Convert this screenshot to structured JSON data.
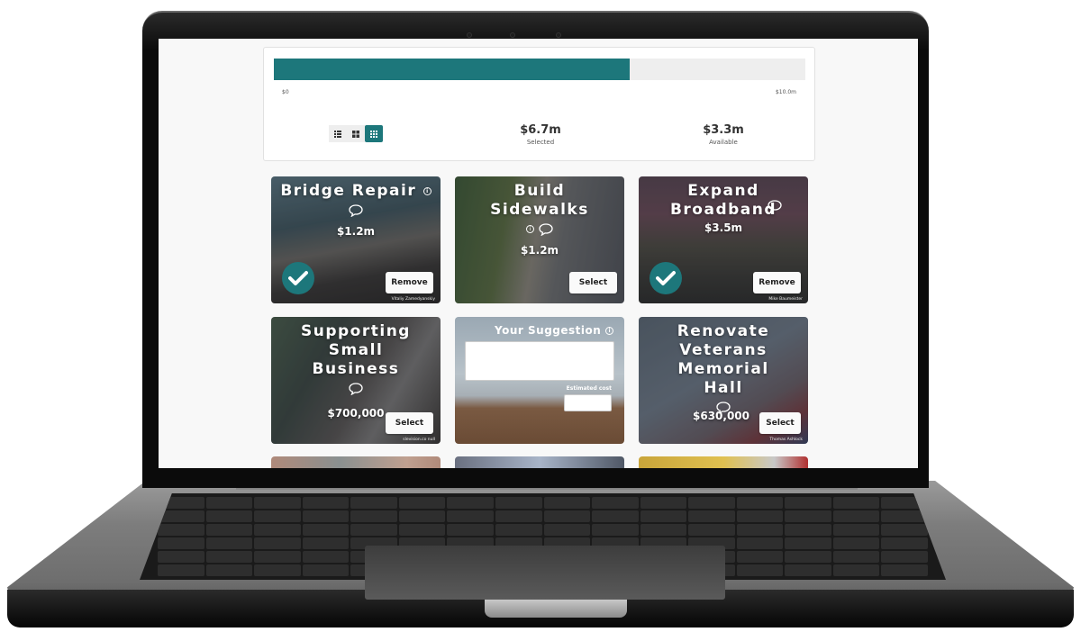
{
  "budget": {
    "min_label": "$0",
    "max_label": "$10.0m",
    "selected_fraction": 0.67,
    "selected_value": "$6.7m",
    "selected_label": "Selected",
    "available_value": "$3.3m",
    "available_label": "Available",
    "view_modes": [
      {
        "name": "list",
        "active": false
      },
      {
        "name": "grid-large",
        "active": false
      },
      {
        "name": "grid-small",
        "active": true
      }
    ]
  },
  "colors": {
    "accent": "#1d777b",
    "track": "#eeeeee",
    "page_bg": "#f8f8f8"
  },
  "projects": [
    {
      "title": "Bridge Repair",
      "has_info": true,
      "price": "$1.2m",
      "selected": true,
      "button": "Remove",
      "credit": "Vitaliy Zamedyanskiy"
    },
    {
      "title": "Build Sidewalks",
      "has_info": true,
      "price": "$1.2m",
      "selected": false,
      "button": "Select",
      "credit": ""
    },
    {
      "title": "Expand Broadband",
      "has_info": false,
      "price": "$3.5m",
      "selected": true,
      "button": "Remove",
      "credit": "Mike Baumeister"
    },
    {
      "title": "Supporting Small Business",
      "has_info": false,
      "price": "$700,000",
      "selected": false,
      "button": "Select",
      "credit": "slevision.co null"
    },
    {
      "title": "Renovate Veterans Memorial Hall",
      "has_info": false,
      "price": "$630,000",
      "selected": false,
      "button": "Select",
      "credit": "Thomas Ashlock"
    }
  ],
  "suggestion": {
    "title": "Your Suggestion",
    "text_value": "",
    "estimated_cost_label": "Estimated cost",
    "estimated_cost_value": ""
  }
}
